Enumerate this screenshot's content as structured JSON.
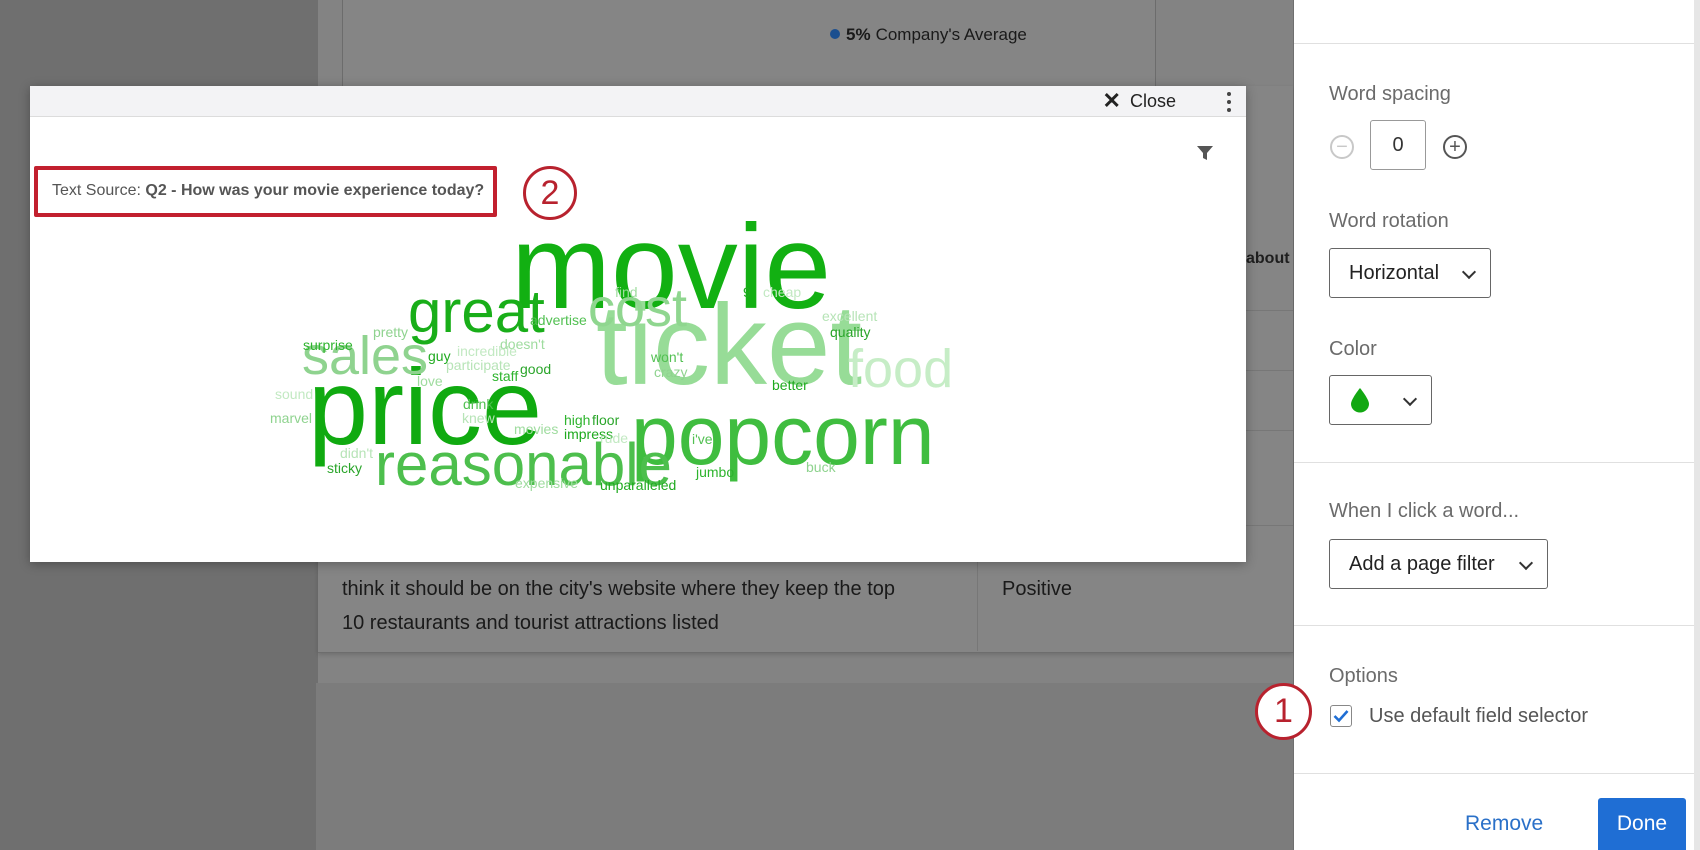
{
  "background": {
    "legend_percent": "5%",
    "legend_label": "Company's Average",
    "about_text": "about",
    "review_line1": "think it should be on the city's website where they keep the top",
    "review_line2": "10 restaurants and tourist attractions listed",
    "sentiment": "Positive"
  },
  "modal": {
    "close_label": "Close",
    "text_source_prefix": "Text Source:",
    "text_source_question": "Q2 - How was your movie experience today?",
    "callout_number": "2",
    "word_cloud": {
      "words": [
        {
          "text": "movie",
          "weight": 10,
          "color": "#12b012"
        },
        {
          "text": "ticket",
          "weight": 9.5,
          "color": "#97dc97"
        },
        {
          "text": "price",
          "weight": 9,
          "color": "#10aa10"
        },
        {
          "text": "popcorn",
          "weight": 7,
          "color": "#3fbd3f"
        },
        {
          "text": "reasonable",
          "weight": 5,
          "color": "#4dbf4d"
        },
        {
          "text": "great",
          "weight": 5,
          "color": "#19ae19"
        },
        {
          "text": "cost",
          "weight": 4.5,
          "color": "#8fd68f"
        },
        {
          "text": "sales",
          "weight": 4.5,
          "color": "#8fd38f"
        },
        {
          "text": "food",
          "weight": 4.5,
          "color": "#c6edc6"
        },
        {
          "text": "find",
          "weight": 1
        },
        {
          "text": "9",
          "weight": 1
        },
        {
          "text": "cheap",
          "weight": 1
        },
        {
          "text": "advertise",
          "weight": 1
        },
        {
          "text": "excellent",
          "weight": 1
        },
        {
          "text": "quality",
          "weight": 1
        },
        {
          "text": "pretty",
          "weight": 1
        },
        {
          "text": "surprise",
          "weight": 1
        },
        {
          "text": "doesn't",
          "weight": 1
        },
        {
          "text": "guy",
          "weight": 1
        },
        {
          "text": "incredible",
          "weight": 1
        },
        {
          "text": "won't",
          "weight": 1
        },
        {
          "text": "participate",
          "weight": 1
        },
        {
          "text": "good",
          "weight": 1
        },
        {
          "text": "crazy",
          "weight": 1
        },
        {
          "text": "staff",
          "weight": 1
        },
        {
          "text": "love",
          "weight": 1
        },
        {
          "text": "better",
          "weight": 1
        },
        {
          "text": "sound",
          "weight": 1
        },
        {
          "text": "drink",
          "weight": 1
        },
        {
          "text": "knew",
          "weight": 1
        },
        {
          "text": "floor",
          "weight": 1
        },
        {
          "text": "marvel",
          "weight": 1
        },
        {
          "text": "high",
          "weight": 1
        },
        {
          "text": "movies",
          "weight": 1
        },
        {
          "text": "impress",
          "weight": 1
        },
        {
          "text": "rude",
          "weight": 1
        },
        {
          "text": "i've",
          "weight": 1
        },
        {
          "text": "didn't",
          "weight": 1
        },
        {
          "text": "sticky",
          "weight": 1
        },
        {
          "text": "buck",
          "weight": 1
        },
        {
          "text": "jumbo",
          "weight": 1
        },
        {
          "text": "expensive",
          "weight": 1
        },
        {
          "text": "unparalleled",
          "weight": 1
        }
      ]
    }
  },
  "panel": {
    "word_spacing_label": "Word spacing",
    "word_spacing_value": "0",
    "word_rotation_label": "Word rotation",
    "word_rotation_value": "Horizontal",
    "color_label": "Color",
    "color_value": "#12a812",
    "click_label": "When I click a word...",
    "click_value": "Add a page filter",
    "options_label": "Options",
    "default_field_selector_label": "Use default field selector",
    "default_field_selector_checked": true,
    "callout_number": "1",
    "remove_label": "Remove",
    "done_label": "Done"
  }
}
